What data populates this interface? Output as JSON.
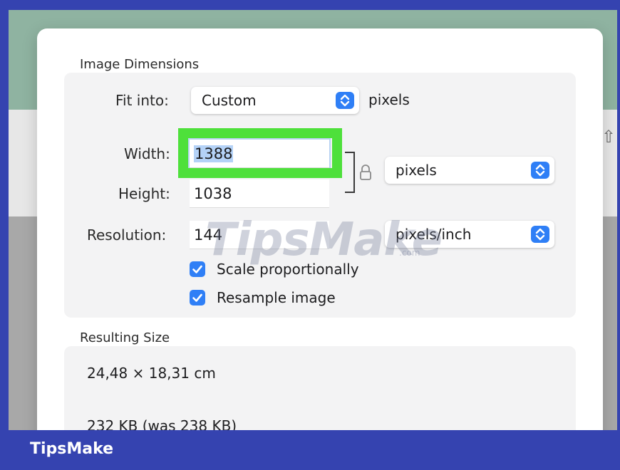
{
  "image_dimensions": {
    "title": "Image Dimensions",
    "fit_into": {
      "label": "Fit into:",
      "value": "Custom",
      "unit": "pixels"
    },
    "width": {
      "label": "Width:",
      "value": "1388"
    },
    "height": {
      "label": "Height:",
      "value": "1038"
    },
    "size_unit": "pixels",
    "resolution": {
      "label": "Resolution:",
      "value": "144",
      "unit": "pixels/inch"
    },
    "scale_proportionally": {
      "label": "Scale proportionally",
      "checked": true
    },
    "resample_image": {
      "label": "Resample image",
      "checked": true
    }
  },
  "resulting_size": {
    "title": "Resulting Size",
    "dimensions": "24,48 × 18,31 cm",
    "file_size": "232 KB (was 238 KB)"
  },
  "watermark": {
    "text": "TipsMake",
    "sub": ".com"
  },
  "footer": {
    "brand": "TipsMake"
  },
  "colors": {
    "frame": "#3543b0",
    "highlight": "#4ee03b",
    "accent": "#2f7ff6"
  },
  "icons": {
    "lock": "lock-icon",
    "share": "share-icon",
    "popup": "up-down-chevron-icon",
    "check": "checkmark-icon"
  }
}
